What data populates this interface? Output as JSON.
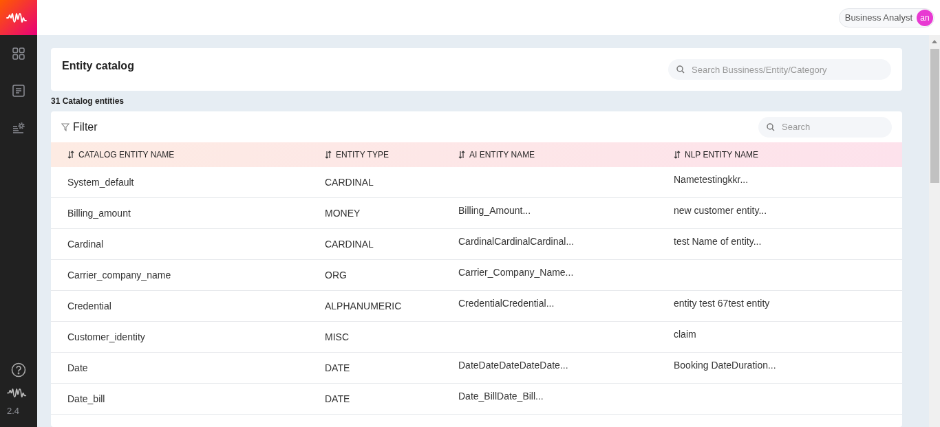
{
  "sidebar": {
    "items": [
      {
        "kind": "grid",
        "selected": false
      },
      {
        "kind": "document",
        "selected": false
      },
      {
        "kind": "settings",
        "selected": false
      }
    ],
    "version": "2.4"
  },
  "topbar": {
    "role": "Business Analyst",
    "avatar": "an"
  },
  "catalog": {
    "title": "Entity catalog",
    "search_placeholder": "Search Bussiness/Entity/Category",
    "count": "31 Catalog entities"
  },
  "table": {
    "filter_label": "Filter",
    "search_placeholder": "Search",
    "columns": [
      "CATALOG ENTITY NAME",
      "ENTITY TYPE",
      "AI ENTITY NAME",
      "NLP ENTITY NAME"
    ],
    "rows": [
      [
        "System_default",
        "CARDINAL",
        "",
        "Nametestingkkr..."
      ],
      [
        "Billing_amount",
        "MONEY",
        "Billing_Amount...",
        "new customer entity..."
      ],
      [
        "Cardinal",
        "CARDINAL",
        "CardinalCardinalCardinal...",
        "test Name of entity..."
      ],
      [
        "Carrier_company_name",
        "ORG",
        "Carrier_Company_Name...",
        ""
      ],
      [
        "Credential",
        "ALPHANUMERIC",
        "CredentialCredential...",
        "entity test 67test entity"
      ],
      [
        "Customer_identity",
        "MISC",
        "",
        "claim"
      ],
      [
        "Date",
        "DATE",
        "DateDateDateDateDate...",
        "Booking DateDuration..."
      ],
      [
        "Date_bill",
        "DATE",
        "Date_BillDate_Bill...",
        ""
      ]
    ]
  }
}
